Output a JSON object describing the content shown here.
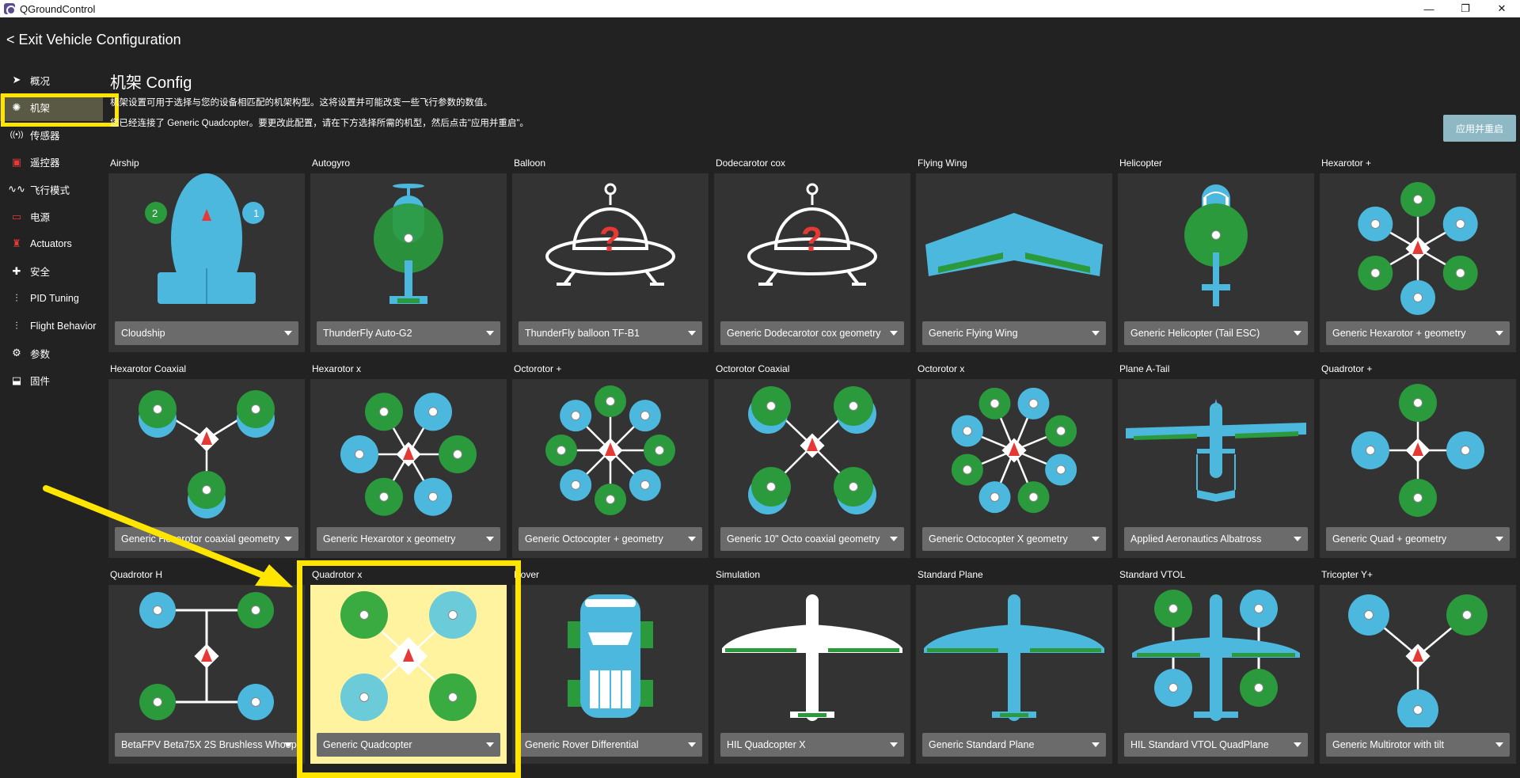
{
  "window": {
    "title": "QGroundControl",
    "minimize": "—",
    "maximize": "❐",
    "close": "✕"
  },
  "header": {
    "exit_label": "< Exit Vehicle Configuration"
  },
  "sidebar": {
    "items": [
      {
        "label": "概况",
        "icon": "plane-icon"
      },
      {
        "label": "机架",
        "icon": "airframe-icon"
      },
      {
        "label": "传感器",
        "icon": "sensor-icon"
      },
      {
        "label": "遥控器",
        "icon": "radio-icon"
      },
      {
        "label": "飞行模式",
        "icon": "flight-mode-icon"
      },
      {
        "label": "电源",
        "icon": "battery-icon"
      },
      {
        "label": "Actuators",
        "icon": "actuator-icon"
      },
      {
        "label": "安全",
        "icon": "safety-icon"
      },
      {
        "label": "PID Tuning",
        "icon": "sliders-icon"
      },
      {
        "label": "Flight Behavior",
        "icon": "sliders-icon"
      },
      {
        "label": "参数",
        "icon": "params-icon"
      },
      {
        "label": "固件",
        "icon": "firmware-icon"
      }
    ],
    "selected": "机架"
  },
  "main": {
    "title": "机架 Config",
    "desc1": "机架设置可用于选择与您的设备相匹配的机架构型。这将设置并可能改变一些飞行参数的数值。",
    "desc2": "您已经连接了 Generic Quadcopter。要更改此配置，请在下方选择所需的机型，然后点击\"应用并重启\"。",
    "apply_label": "应用并重启"
  },
  "tiles": [
    {
      "name": "Airship",
      "selection": "Cloudship",
      "kind": "airship"
    },
    {
      "name": "Autogyro",
      "selection": "ThunderFly Auto-G2",
      "kind": "autogyro"
    },
    {
      "name": "Balloon",
      "selection": "ThunderFly balloon TF-B1",
      "kind": "ufo"
    },
    {
      "name": "Dodecarotor cox",
      "selection": "Generic Dodecarotor cox geometry",
      "kind": "ufo"
    },
    {
      "name": "Flying Wing",
      "selection": "Generic Flying Wing",
      "kind": "wing"
    },
    {
      "name": "Helicopter",
      "selection": "Generic Helicopter (Tail ESC)",
      "kind": "heli"
    },
    {
      "name": "Hexarotor +",
      "selection": "Generic Hexarotor + geometry",
      "kind": "hexplus"
    },
    {
      "name": "Hexarotor Coaxial",
      "selection": "Generic Hexarotor coaxial geometry",
      "kind": "hexcoax"
    },
    {
      "name": "Hexarotor x",
      "selection": "Generic Hexarotor x geometry",
      "kind": "hexx"
    },
    {
      "name": "Octorotor +",
      "selection": "Generic Octocopter + geometry",
      "kind": "octplus"
    },
    {
      "name": "Octorotor Coaxial",
      "selection": "Generic 10\" Octo coaxial geometry",
      "kind": "octcoax"
    },
    {
      "name": "Octorotor x",
      "selection": "Generic Octocopter X geometry",
      "kind": "octx"
    },
    {
      "name": "Plane A-Tail",
      "selection": "Applied Aeronautics Albatross",
      "kind": "atail"
    },
    {
      "name": "Quadrotor +",
      "selection": "Generic Quad + geometry",
      "kind": "quadplus"
    },
    {
      "name": "Quadrotor H",
      "selection": "BetaFPV Beta75X 2S Brushless Whoop",
      "kind": "quadh"
    },
    {
      "name": "Quadrotor x",
      "selection": "Generic Quadcopter",
      "kind": "quadx",
      "active": true
    },
    {
      "name": "Rover",
      "selection": "Generic Rover Differential",
      "kind": "rover"
    },
    {
      "name": "Simulation",
      "selection": "HIL Quadcopter X",
      "kind": "simplane"
    },
    {
      "name": "Standard Plane",
      "selection": "Generic Standard Plane",
      "kind": "stdplane"
    },
    {
      "name": "Standard VTOL",
      "selection": "HIL Standard VTOL QuadPlane",
      "kind": "vtol"
    },
    {
      "name": "Tricopter Y+",
      "selection": "Generic Multirotor with tilt",
      "kind": "tri"
    }
  ],
  "colors": {
    "blue": "#4cb8de",
    "green": "#2a9a3c",
    "red": "#e53935",
    "highlight": "#ffe500"
  }
}
